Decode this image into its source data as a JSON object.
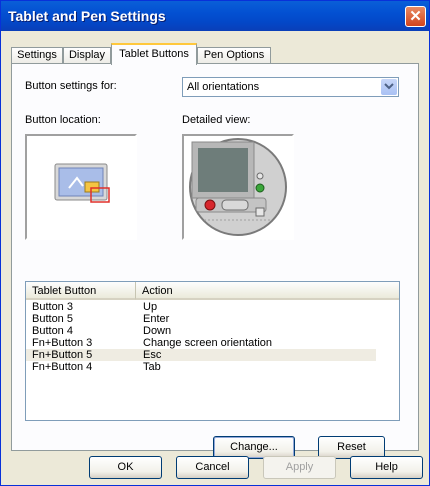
{
  "window": {
    "title": "Tablet and Pen Settings"
  },
  "tabs": [
    {
      "label": "Settings"
    },
    {
      "label": "Display"
    },
    {
      "label": "Tablet Buttons"
    },
    {
      "label": "Pen Options"
    }
  ],
  "panel": {
    "button_settings_label": "Button settings for:",
    "orientation_select": {
      "value": "All orientations"
    },
    "button_location_label": "Button location:",
    "detailed_view_label": "Detailed view:"
  },
  "table": {
    "headers": [
      "Tablet Button",
      "Action"
    ],
    "rows": [
      {
        "button": "Button 3",
        "action": "Up"
      },
      {
        "button": "Button 5",
        "action": "Enter"
      },
      {
        "button": "Button 4",
        "action": "Down"
      },
      {
        "button": "Fn+Button 3",
        "action": "Change screen orientation"
      },
      {
        "button": "Fn+Button 5",
        "action": "Esc"
      },
      {
        "button": "Fn+Button 4",
        "action": "Tab"
      }
    ],
    "selected_row": 4
  },
  "buttons": {
    "change": "Change...",
    "reset": "Reset",
    "ok": "OK",
    "cancel": "Cancel",
    "apply": "Apply",
    "help": "Help"
  },
  "colors": {
    "titlebar": "#0350d2",
    "selection_row": "#efece2",
    "tab_highlight": "#ffc83c"
  }
}
